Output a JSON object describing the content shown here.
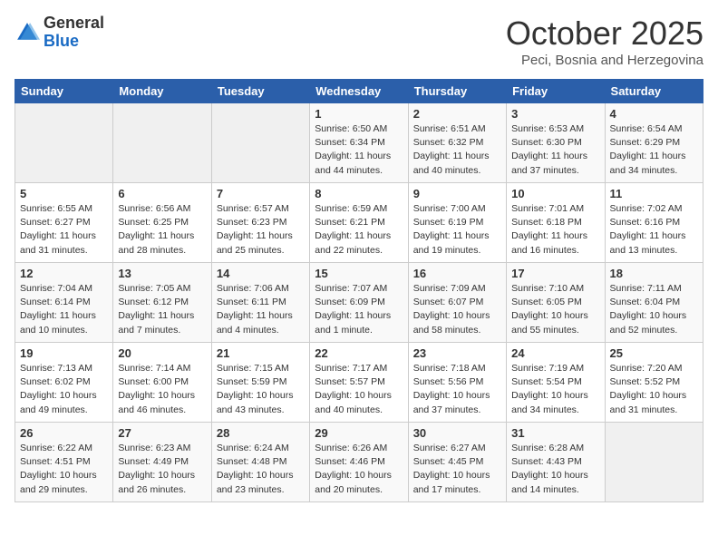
{
  "header": {
    "logo_line1": "General",
    "logo_line2": "Blue",
    "month_title": "October 2025",
    "location": "Peci, Bosnia and Herzegovina"
  },
  "weekdays": [
    "Sunday",
    "Monday",
    "Tuesday",
    "Wednesday",
    "Thursday",
    "Friday",
    "Saturday"
  ],
  "weeks": [
    [
      {
        "day": "",
        "info": ""
      },
      {
        "day": "",
        "info": ""
      },
      {
        "day": "",
        "info": ""
      },
      {
        "day": "1",
        "info": "Sunrise: 6:50 AM\nSunset: 6:34 PM\nDaylight: 11 hours\nand 44 minutes."
      },
      {
        "day": "2",
        "info": "Sunrise: 6:51 AM\nSunset: 6:32 PM\nDaylight: 11 hours\nand 40 minutes."
      },
      {
        "day": "3",
        "info": "Sunrise: 6:53 AM\nSunset: 6:30 PM\nDaylight: 11 hours\nand 37 minutes."
      },
      {
        "day": "4",
        "info": "Sunrise: 6:54 AM\nSunset: 6:29 PM\nDaylight: 11 hours\nand 34 minutes."
      }
    ],
    [
      {
        "day": "5",
        "info": "Sunrise: 6:55 AM\nSunset: 6:27 PM\nDaylight: 11 hours\nand 31 minutes."
      },
      {
        "day": "6",
        "info": "Sunrise: 6:56 AM\nSunset: 6:25 PM\nDaylight: 11 hours\nand 28 minutes."
      },
      {
        "day": "7",
        "info": "Sunrise: 6:57 AM\nSunset: 6:23 PM\nDaylight: 11 hours\nand 25 minutes."
      },
      {
        "day": "8",
        "info": "Sunrise: 6:59 AM\nSunset: 6:21 PM\nDaylight: 11 hours\nand 22 minutes."
      },
      {
        "day": "9",
        "info": "Sunrise: 7:00 AM\nSunset: 6:19 PM\nDaylight: 11 hours\nand 19 minutes."
      },
      {
        "day": "10",
        "info": "Sunrise: 7:01 AM\nSunset: 6:18 PM\nDaylight: 11 hours\nand 16 minutes."
      },
      {
        "day": "11",
        "info": "Sunrise: 7:02 AM\nSunset: 6:16 PM\nDaylight: 11 hours\nand 13 minutes."
      }
    ],
    [
      {
        "day": "12",
        "info": "Sunrise: 7:04 AM\nSunset: 6:14 PM\nDaylight: 11 hours\nand 10 minutes."
      },
      {
        "day": "13",
        "info": "Sunrise: 7:05 AM\nSunset: 6:12 PM\nDaylight: 11 hours\nand 7 minutes."
      },
      {
        "day": "14",
        "info": "Sunrise: 7:06 AM\nSunset: 6:11 PM\nDaylight: 11 hours\nand 4 minutes."
      },
      {
        "day": "15",
        "info": "Sunrise: 7:07 AM\nSunset: 6:09 PM\nDaylight: 11 hours\nand 1 minute."
      },
      {
        "day": "16",
        "info": "Sunrise: 7:09 AM\nSunset: 6:07 PM\nDaylight: 10 hours\nand 58 minutes."
      },
      {
        "day": "17",
        "info": "Sunrise: 7:10 AM\nSunset: 6:05 PM\nDaylight: 10 hours\nand 55 minutes."
      },
      {
        "day": "18",
        "info": "Sunrise: 7:11 AM\nSunset: 6:04 PM\nDaylight: 10 hours\nand 52 minutes."
      }
    ],
    [
      {
        "day": "19",
        "info": "Sunrise: 7:13 AM\nSunset: 6:02 PM\nDaylight: 10 hours\nand 49 minutes."
      },
      {
        "day": "20",
        "info": "Sunrise: 7:14 AM\nSunset: 6:00 PM\nDaylight: 10 hours\nand 46 minutes."
      },
      {
        "day": "21",
        "info": "Sunrise: 7:15 AM\nSunset: 5:59 PM\nDaylight: 10 hours\nand 43 minutes."
      },
      {
        "day": "22",
        "info": "Sunrise: 7:17 AM\nSunset: 5:57 PM\nDaylight: 10 hours\nand 40 minutes."
      },
      {
        "day": "23",
        "info": "Sunrise: 7:18 AM\nSunset: 5:56 PM\nDaylight: 10 hours\nand 37 minutes."
      },
      {
        "day": "24",
        "info": "Sunrise: 7:19 AM\nSunset: 5:54 PM\nDaylight: 10 hours\nand 34 minutes."
      },
      {
        "day": "25",
        "info": "Sunrise: 7:20 AM\nSunset: 5:52 PM\nDaylight: 10 hours\nand 31 minutes."
      }
    ],
    [
      {
        "day": "26",
        "info": "Sunrise: 6:22 AM\nSunset: 4:51 PM\nDaylight: 10 hours\nand 29 minutes."
      },
      {
        "day": "27",
        "info": "Sunrise: 6:23 AM\nSunset: 4:49 PM\nDaylight: 10 hours\nand 26 minutes."
      },
      {
        "day": "28",
        "info": "Sunrise: 6:24 AM\nSunset: 4:48 PM\nDaylight: 10 hours\nand 23 minutes."
      },
      {
        "day": "29",
        "info": "Sunrise: 6:26 AM\nSunset: 4:46 PM\nDaylight: 10 hours\nand 20 minutes."
      },
      {
        "day": "30",
        "info": "Sunrise: 6:27 AM\nSunset: 4:45 PM\nDaylight: 10 hours\nand 17 minutes."
      },
      {
        "day": "31",
        "info": "Sunrise: 6:28 AM\nSunset: 4:43 PM\nDaylight: 10 hours\nand 14 minutes."
      },
      {
        "day": "",
        "info": ""
      }
    ]
  ]
}
